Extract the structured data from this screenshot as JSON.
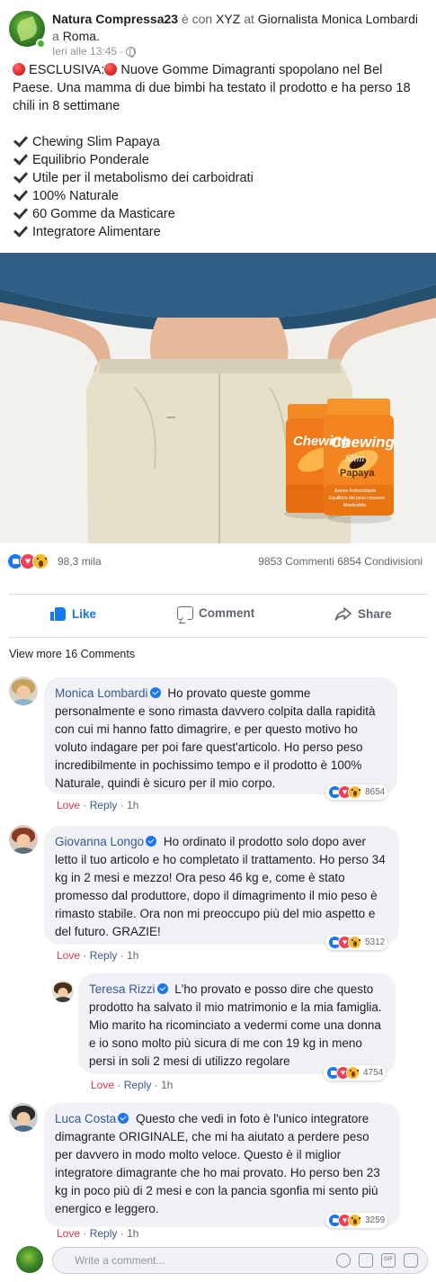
{
  "post": {
    "author": "Natura Compressa23",
    "with_text": "è con",
    "tagged": "XYZ",
    "at_text": "at",
    "place": "Giornalista Monica Lombardi",
    "in_text": "a",
    "city": "Roma.",
    "time": "Ieri alle 13:45",
    "separator": "·",
    "headline_prefix": "ESCLUSIVA:",
    "headline": "Nuove Gomme Dimagranti spopolano nel Bel Paese.",
    "body": "Una mamma di due bimbi ha testato il prodotto e ha perso 18 chili in 8 settimane",
    "checklist": [
      "Chewing Slim Papaya",
      "Equilibrio Ponderale",
      "Utile per il metabolismo dei carboidrati",
      "100% Naturale",
      "60 Gomme da Masticare",
      "Integratore Alimentare"
    ],
    "product": {
      "brand_line1": "Chewing",
      "brand_line2": "Slim",
      "flavor": "Papaya",
      "sub1": "Azione Antiossidante",
      "sub2": "Equilibrio del peso corporeo",
      "sub3": "Masticabile"
    }
  },
  "stats": {
    "reactions_count": "98,3 mila",
    "comments_shares": "9853 Commenti 6854 Condivisioni"
  },
  "actions": {
    "like": "Like",
    "comment": "Comment",
    "share": "Share"
  },
  "comments_header": "View more 16 Comments",
  "comments": [
    {
      "name": "Monica Lombardi",
      "text": "Ho provato queste gomme personalmente e sono rimasta davvero colpita dalla rapidità con cui mi hanno fatto dimagrire, e per questo motivo ho voluto indagare per poi fare quest'articolo. Ho perso peso incredibilmente in pochissimo tempo e il prodotto è 100% Naturale, quindi è sicuro per il mio corpo.",
      "reactions": "8654",
      "love": "Love",
      "reply": "Reply",
      "time": "1h"
    },
    {
      "name": "Giovanna Longo",
      "text": "Ho ordinato il prodotto solo dopo aver letto il tuo articolo e ho completato il trattamento. Ho perso 34 kg in 2 mesi e mezzo! Ora peso 46 kg e, come è stato promesso dal produttore, dopo il dimagrimento il mio peso è rimasto stabile. Ora non mi preoccupo più del mio aspetto e del futuro. GRAZIE!",
      "reactions": "5312",
      "love": "Love",
      "reply": "Reply",
      "time": "1h"
    },
    {
      "name": "Teresa Rizzi",
      "text": "L'ho provato e posso dire che questo prodotto ha salvato il mio matrimonio e la mia famiglia. Mio marito ha ricominciato a vedermi come una donna e io sono molto più sicura di me con 19 kg in meno persi in soli 2 mesi di utilizzo regolare",
      "reactions": "4754",
      "love": "Love",
      "reply": "Reply",
      "time": "1h"
    },
    {
      "name": "Luca Costa",
      "text": "Questo che vedi in foto è l'unico integratore dimagrante ORIGINALE, che mi ha aiutato a perdere peso per davvero in modo molto veloce. Questo è il miglior integratore dimagrante che ho mai provato. Ho perso ben 23 kg in poco più di 2 mesi e con la pancia sgonfia mi sento più energico e leggero.",
      "reactions": "3259",
      "love": "Love",
      "reply": "Reply",
      "time": "1h"
    }
  ],
  "write_comment": {
    "placeholder": "Write a comment..."
  },
  "icons": [
    "online-dot",
    "globe-icon",
    "red-circle-emoji",
    "check-mark-icon",
    "like-reaction-icon",
    "love-reaction-icon",
    "wow-reaction-icon",
    "thumbs-up-icon",
    "comment-icon",
    "share-icon",
    "verified-badge-icon",
    "emoji-icon",
    "camera-icon",
    "gif-icon",
    "sticker-icon"
  ],
  "colors": {
    "facebook_blue": "#1877f2",
    "link_blue": "#385898",
    "love_red": "#e4394f",
    "bubble_gray": "#f0f2f5",
    "muted_gray": "#606770",
    "product_orange": "#f07a1a"
  }
}
